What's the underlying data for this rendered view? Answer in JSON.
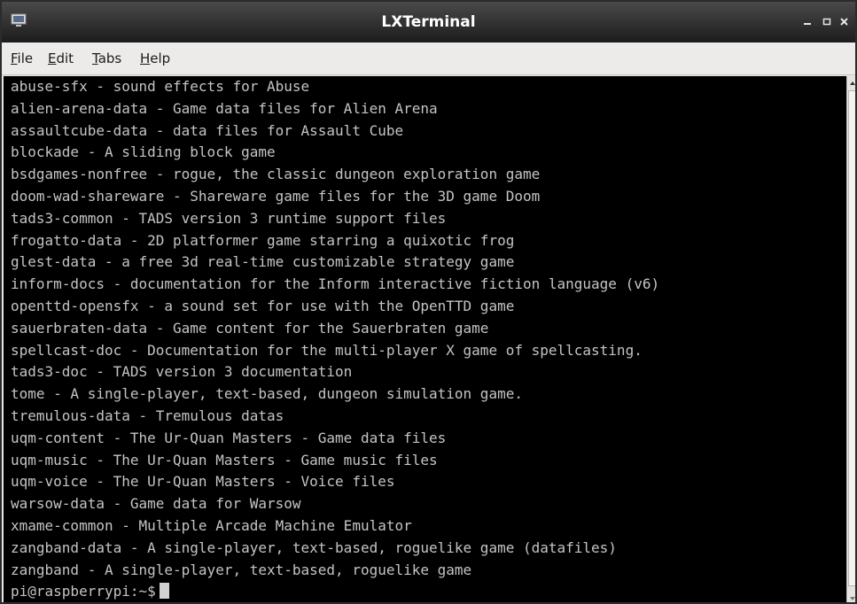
{
  "window": {
    "title": "LXTerminal",
    "icon": "terminal-icon",
    "controls": [
      "minimize-icon",
      "maximize-icon",
      "close-icon"
    ]
  },
  "menubar": {
    "items": [
      {
        "mnemonic": "F",
        "rest": "ile"
      },
      {
        "mnemonic": "E",
        "rest": "dit"
      },
      {
        "mnemonic": "T",
        "rest": "abs"
      },
      {
        "mnemonic": "H",
        "rest": "elp"
      }
    ]
  },
  "terminal": {
    "lines": [
      "abuse-sfx - sound effects for Abuse",
      "alien-arena-data - Game data files for Alien Arena",
      "assaultcube-data - data files for Assault Cube",
      "blockade - A sliding block game",
      "bsdgames-nonfree - rogue, the classic dungeon exploration game",
      "doom-wad-shareware - Shareware game files for the 3D game Doom",
      "tads3-common - TADS version 3 runtime support files",
      "frogatto-data - 2D platformer game starring a quixotic frog",
      "glest-data - a free 3d real-time customizable strategy game",
      "inform-docs - documentation for the Inform interactive fiction language (v6)",
      "openttd-opensfx - a sound set for use with the OpenTTD game",
      "sauerbraten-data - Game content for the Sauerbraten game",
      "spellcast-doc - Documentation for the multi-player X game of spellcasting.",
      "tads3-doc - TADS version 3 documentation",
      "tome - A single-player, text-based, dungeon simulation game.",
      "tremulous-data - Tremulous datas",
      "uqm-content - The Ur-Quan Masters - Game data files",
      "uqm-music - The Ur-Quan Masters - Game music files",
      "uqm-voice - The Ur-Quan Masters - Voice files",
      "warsow-data - Game data for Warsow",
      "xmame-common - Multiple Arcade Machine Emulator",
      "zangband-data - A single-player, text-based, roguelike game (datafiles)",
      "zangband - A single-player, text-based, roguelike game"
    ],
    "prompt": "pi@raspberrypi:~$"
  },
  "colors": {
    "background": "#000000",
    "text": "#c4c4c4",
    "titlebar": "#2a2a2a"
  }
}
